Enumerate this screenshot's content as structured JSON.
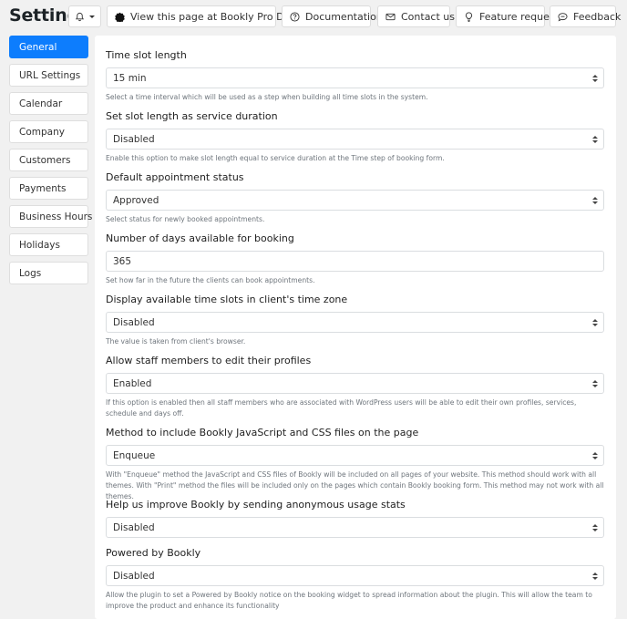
{
  "header": {
    "title": "Settings",
    "buttons": [
      {
        "label": "View this page at Bookly Pro Demo",
        "icon": "bookly-logo-icon"
      },
      {
        "label": "Documentation",
        "icon": "question-circle-icon"
      },
      {
        "label": "Contact us",
        "icon": "envelope-icon"
      },
      {
        "label": "Feature requests",
        "icon": "lightbulb-icon"
      },
      {
        "label": "Feedback",
        "icon": "chat-icon"
      }
    ],
    "notifications_icon": "bell-icon"
  },
  "sidebar": {
    "items": [
      {
        "label": "General",
        "active": true
      },
      {
        "label": "URL Settings"
      },
      {
        "label": "Calendar"
      },
      {
        "label": "Company"
      },
      {
        "label": "Customers"
      },
      {
        "label": "Payments"
      },
      {
        "label": "Business Hours"
      },
      {
        "label": "Holidays"
      },
      {
        "label": "Logs"
      }
    ]
  },
  "settings": [
    {
      "label": "Time slot length",
      "type": "select",
      "value": "15 min",
      "help": "Select a time interval which will be used as a step when building all time slots in the system."
    },
    {
      "label": "Set slot length as service duration",
      "type": "select",
      "value": "Disabled",
      "help": "Enable this option to make slot length equal to service duration at the Time step of booking form."
    },
    {
      "label": "Default appointment status",
      "type": "select",
      "value": "Approved",
      "help": "Select status for newly booked appointments."
    },
    {
      "label": "Number of days available for booking",
      "type": "input",
      "value": "365",
      "help": "Set how far in the future the clients can book appointments."
    },
    {
      "label": "Display available time slots in client's time zone",
      "type": "select",
      "value": "Disabled",
      "help": "The value is taken from client's browser."
    },
    {
      "label": "Allow staff members to edit their profiles",
      "type": "select",
      "value": "Enabled",
      "help": "If this option is enabled then all staff members who are associated with WordPress users will be able to edit their own profiles, services, schedule and days off."
    },
    {
      "label": "Method to include Bookly JavaScript and CSS files on the page",
      "type": "select",
      "value": "Enqueue",
      "help": "With \"Enqueue\" method the JavaScript and CSS files of Bookly will be included on all pages of your website. This method should work with all themes. With \"Print\" method the files will be included only on the pages which contain Bookly booking form. This method may not work with all themes."
    },
    {
      "label": "Help us improve Bookly by sending anonymous usage stats",
      "type": "select",
      "value": "Disabled",
      "help": ""
    },
    {
      "label": "Powered by Bookly",
      "type": "select",
      "value": "Disabled",
      "help": "Allow the plugin to set a Powered by Bookly notice on the booking widget to spread information about the plugin. This will allow the team to improve the product and enhance its functionality"
    }
  ],
  "colors": {
    "accent": "#0d7dfd",
    "background": "#f1f1f1"
  }
}
